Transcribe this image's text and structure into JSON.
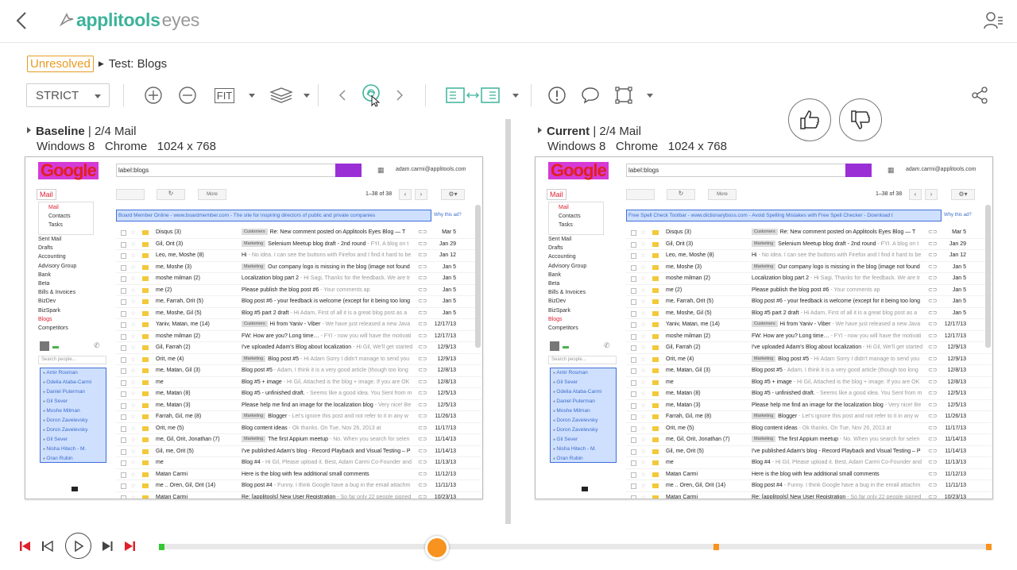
{
  "header": {
    "logo_brand": "applitools",
    "logo_product": "eyes"
  },
  "breadcrumb": {
    "status": "Unresolved",
    "title": "Test: Blogs"
  },
  "toolbar": {
    "match_level": "STRICT",
    "fit_label": "FIT"
  },
  "baseline": {
    "title": "Baseline",
    "step": "2/4 Mail",
    "os": "Windows 8",
    "browser": "Chrome",
    "viewport": "1024 x 768"
  },
  "current": {
    "title": "Current",
    "step": "2/4 Mail",
    "os": "Windows 8",
    "browser": "Chrome",
    "viewport": "1024 x 768"
  },
  "gmail": {
    "logo": "Google",
    "search": "label:blogs",
    "user": "adam.carmi@applitools.com",
    "mail_label": "Mail",
    "menu": [
      "Mail",
      "Contacts",
      "Tasks"
    ],
    "more": "More",
    "count": "1–38 of 38",
    "labels": [
      "Sent Mail",
      "Drafts",
      "Accounting",
      "Advisory Group",
      "Bank",
      "Beta",
      "Bills & Invoices",
      "BizDev",
      "BizSpark",
      "Blogs",
      "Competitors"
    ],
    "search_people": "Search people...",
    "why": "Why this ad?",
    "contacts_baseline": [
      "Amir Rosman",
      "Odelia Ataba-Carmi",
      "Daniel Puterman",
      "Gil Sever",
      "Moshe Milman",
      "Doron Zavelevsky",
      "Doron Zavelevsky",
      "Gil Sever",
      "Nisha Hitech - M.",
      "Oran Rubin"
    ],
    "contacts_current": [
      "Amir Rosman",
      "Gil Sever",
      "Odelia Ataba-Carmi",
      "Daniel Puterman",
      "Moshe Milman",
      "Doron Zavelevsky",
      "Doron Zavelevsky",
      "Gil Sever",
      "Nisha Hitech - M.",
      "Oran Rubin"
    ],
    "ad_baseline": "Board Member Online - www.boardmember.com - The site for inspiring directors of public and private companies",
    "ad_current": "Free Spell Check Toolbar - www.dictionaryboss.com - Avoid Spelling Mistakes with Free Spell Checker - Download t",
    "rows": [
      {
        "from": "Disqus (3)",
        "tag": "Customers",
        "subject": "Re: New comment posted on Applitools Eyes Blog — T",
        "snippet": "",
        "date": "Mar 5"
      },
      {
        "from": "Gil, Orit (3)",
        "tag": "Marketing",
        "subject": "Selenium Meetup blog draft - 2nd round",
        "snippet": " - FYI. A blog on t",
        "date": "Jan 29"
      },
      {
        "from": "Leo, me, Moshe (8)",
        "tag": "",
        "subject": "Hi",
        "snippet": " - No idea. I can see the buttons with Firefox and I find it hard to be",
        "date": "Jan 12"
      },
      {
        "from": "me, Moshe (3)",
        "tag": "Marketing",
        "subject": "Our company logo is missing in the blog (image not found",
        "snippet": "",
        "date": "Jan 5"
      },
      {
        "from": "moshe milman (2)",
        "tag": "",
        "subject": "Localization blog part 2",
        "snippet": " - Hi Sagi, Thanks for the feedback. We are tr",
        "date": "Jan 5"
      },
      {
        "from": "me (2)",
        "tag": "",
        "subject": "Please publish the blog post #6",
        "snippet": " - Your comments ap",
        "date": "Jan 5"
      },
      {
        "from": "me, Farrah, Orit (5)",
        "tag": "",
        "subject": "Blog post #6 - your feedback is welcome (except for it being too long",
        "snippet": "",
        "date": "Jan 5"
      },
      {
        "from": "me, Moshe, Gil (5)",
        "tag": "",
        "subject": "Blog #5 part 2 draft",
        "snippet": " - Hi Adam, First of all it is a great blog post as a",
        "date": "Jan 5"
      },
      {
        "from": "Yaniv, Matan, me (14)",
        "tag": "Customers",
        "subject": "Hi from Yaniv - Viber",
        "snippet": " - We have just released a new Java",
        "date": "12/17/13"
      },
      {
        "from": "moshe milman (2)",
        "tag": "",
        "subject": "FW: How are you? Long time…",
        "snippet": " - FYI - now you will have the motivati",
        "date": "12/17/13"
      },
      {
        "from": "Gil, Farrah (2)",
        "tag": "",
        "subject": "I've uploaded Adam's Blog about localization",
        "snippet": " - Hi Gil, We'll get started",
        "date": "12/9/13"
      },
      {
        "from": "Orit, me (4)",
        "tag": "Marketing",
        "subject": "Blog post #5",
        "snippet": " - Hi Adam Sorry I didn't manage to send you",
        "date": "12/9/13"
      },
      {
        "from": "me, Matan, Gil (3)",
        "tag": "",
        "subject": "Blog post #5",
        "snippet": " - Adam, I think it is a very good article (though too long",
        "date": "12/8/13"
      },
      {
        "from": "me",
        "tag": "",
        "subject": "Blog #5 + image",
        "snippet": " - Hi Gil, Attached is the blog + image. If you are OK",
        "date": "12/8/13"
      },
      {
        "from": "me, Matan (8)",
        "tag": "",
        "subject": "Blog #5 - unfinished draft.",
        "snippet": " - Seems like a good idea. You Sent from m",
        "date": "12/5/13"
      },
      {
        "from": "me, Matan (3)",
        "tag": "",
        "subject": "Please help me find an image for the localization blog",
        "snippet": " - Very nice! Be",
        "date": "12/5/13"
      },
      {
        "from": "Farrah, Gil, me (8)",
        "tag": "Marketing",
        "subject": "Blogger",
        "snippet": " - Let's ignore this post and not refer to it in any w",
        "date": "11/26/13"
      },
      {
        "from": "Orit, me (5)",
        "tag": "",
        "subject": "Blog content ideas",
        "snippet": " - Ok thanks. On Tue, Nov 26, 2013 at",
        "date": "11/17/13"
      },
      {
        "from": "me, Gil, Orit, Jonathan (7)",
        "tag": "Marketing",
        "subject": "The first Appium meetup",
        "snippet": " - No. When you search for selen",
        "date": "11/14/13"
      },
      {
        "from": "Gil, me, Orit (5)",
        "tag": "",
        "subject": "I've published Adam's blog - Record Playback and Visual Testing – P",
        "snippet": "",
        "date": "11/14/13"
      },
      {
        "from": "me",
        "tag": "",
        "subject": "Blog #4",
        "snippet": " - Hi Gil, Please upload it. Best, Adam Carmi Co-Founder and",
        "date": "11/13/13"
      },
      {
        "from": "Matan Carmi",
        "tag": "",
        "subject": "Here is the blog with few additional small comments",
        "snippet": "",
        "date": "11/12/13"
      },
      {
        "from": "me .. Oren, Gil, Orit (14)",
        "tag": "",
        "subject": "Blog post #4",
        "snippet": " - Funny. I think Google have a bug in the email attachm",
        "date": "11/11/13"
      },
      {
        "from": "Matan Carmi",
        "tag": "",
        "subject": "Re: [applitools] New User Registration",
        "snippet": " - So far only 22 people signed",
        "date": "10/23/13"
      }
    ]
  },
  "colors": {
    "accent": "#3cb39b",
    "status_unresolved": "#e89b22",
    "timeline_knob": "#f7931e",
    "player_red": "#e0202a",
    "marker_green": "#32c832",
    "marker_orange": "#f7931e"
  },
  "timeline": {
    "position_fraction": 0.33,
    "markers": [
      "green",
      "orange",
      "orange"
    ]
  }
}
